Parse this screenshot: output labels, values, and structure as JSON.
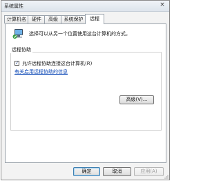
{
  "window": {
    "title": "系统属性",
    "close_glyph": "×"
  },
  "tabs": [
    {
      "label": "计算机名",
      "active": false
    },
    {
      "label": "硬件",
      "active": false
    },
    {
      "label": "高级",
      "active": false
    },
    {
      "label": "系统保护",
      "active": false
    },
    {
      "label": "远程",
      "active": true
    }
  ],
  "remote": {
    "icon": "remote-desktop-icon",
    "intro": "选择可以从另一个位置使用这台计算机的方式。",
    "group_title": "远程协助",
    "allow_label": "允许远程协助连接这台计算机(R)",
    "allow_checked": true,
    "check_glyph": "✓",
    "info_link": "有关启用远程协助的信息",
    "advanced_button": "高级(V)..."
  },
  "footer": {
    "ok": "确定",
    "cancel": "取消",
    "apply": "应用(A)"
  },
  "colors": {
    "link": "#0a46b5",
    "accent": "#3c7fb1"
  }
}
